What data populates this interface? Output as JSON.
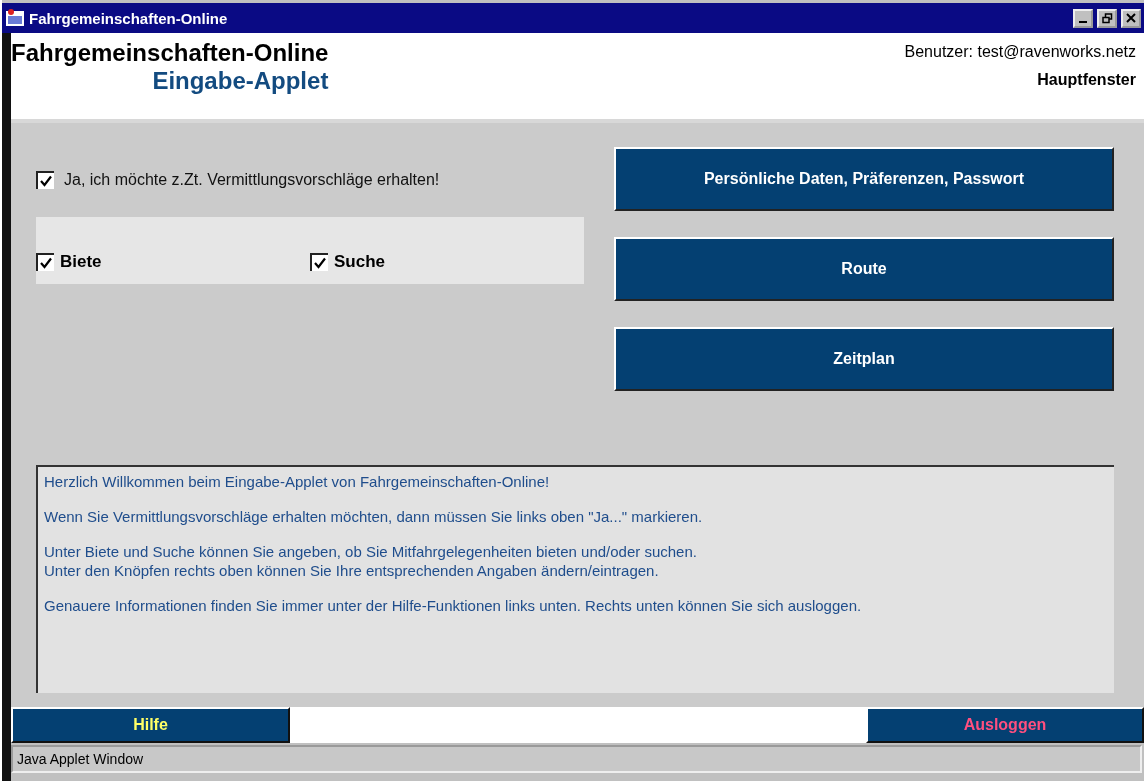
{
  "window": {
    "title": "Fahrgemeinschaften-Online"
  },
  "header": {
    "title": "Fahrgemeinschaften-Online",
    "subtitle": "Eingabe-Applet",
    "user": "Benutzer: test@ravenworks.netz",
    "view": "Hauptfenster"
  },
  "opt_in": {
    "label": "Ja, ich möchte z.Zt. Vermittlungsvorschläge erhalten!",
    "checked": true
  },
  "options": [
    {
      "label": "Biete",
      "checked": true
    },
    {
      "label": "Suche",
      "checked": true
    }
  ],
  "buttons": [
    "Persönliche Daten, Präferenzen, Passwort",
    "Route",
    "Zeitplan"
  ],
  "messages": [
    [
      "Herzlich Willkommen beim Eingabe-Applet von Fahrgemeinschaften-Online!"
    ],
    [
      "Wenn Sie Vermittlungsvorschläge erhalten möchten, dann müssen Sie links oben \"Ja...\" markieren."
    ],
    [
      "Unter Biete und Suche können Sie angeben, ob Sie Mitfahrgelegenheiten bieten und/oder suchen.",
      "Unter den Knöpfen rechts oben können Sie Ihre entsprechenden Angaben ändern/eintragen."
    ],
    [
      "Genauere Informationen finden Sie immer unter der Hilfe-Funktionen links unten. Rechts unten können Sie sich ausloggen."
    ]
  ],
  "footer": {
    "help": "Hilfe",
    "logout": "Ausloggen"
  },
  "status_bar": "Java Applet Window"
}
